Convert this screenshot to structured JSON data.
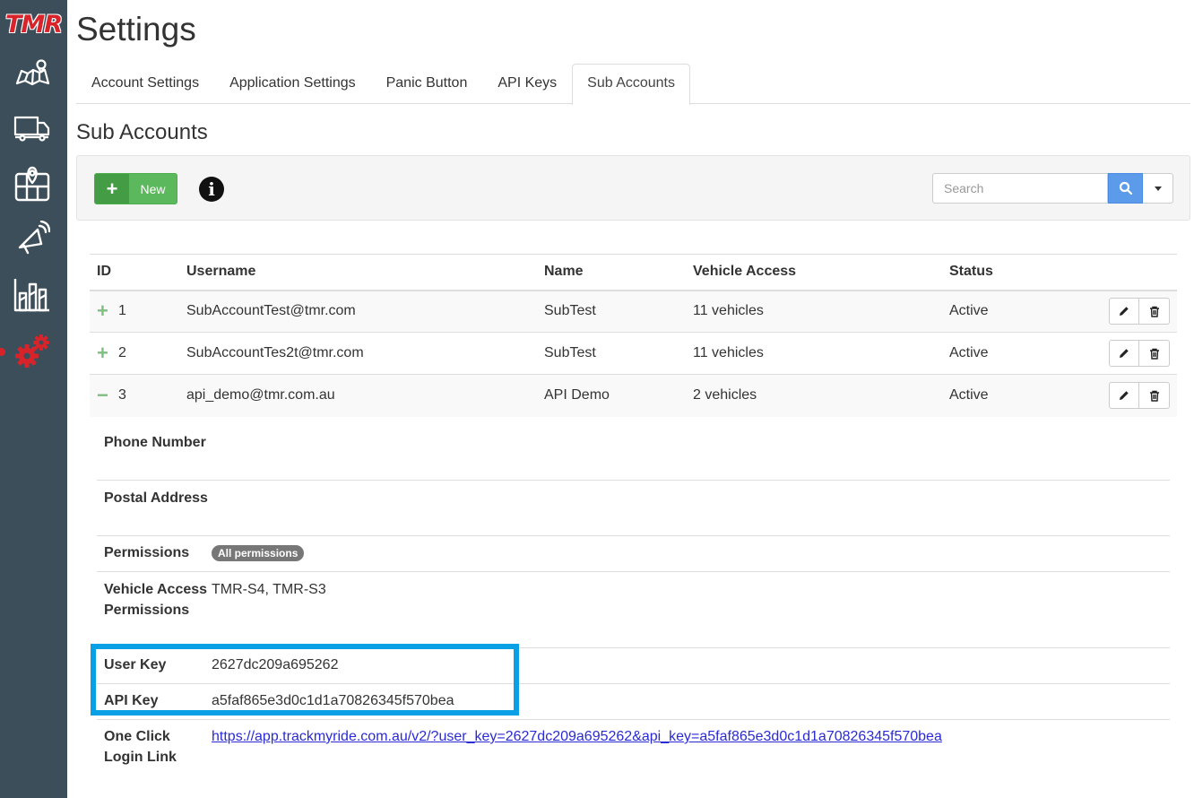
{
  "app": {
    "logo_text": "TMR",
    "accent_color": "#d9232a",
    "sidebar_color": "#3c4e5a"
  },
  "sidebar": {
    "items": [
      {
        "icon": "map-icon"
      },
      {
        "icon": "truck-icon"
      },
      {
        "icon": "location-map-icon"
      },
      {
        "icon": "megaphone-icon"
      },
      {
        "icon": "bar-chart-icon"
      },
      {
        "icon": "gears-icon",
        "active": true
      }
    ]
  },
  "header": {
    "title": "Settings",
    "tabs": [
      {
        "label": "Account Settings"
      },
      {
        "label": "Application Settings"
      },
      {
        "label": "Panic Button"
      },
      {
        "label": "API Keys"
      },
      {
        "label": "Sub Accounts",
        "active": true
      }
    ]
  },
  "section": {
    "title": "Sub Accounts"
  },
  "toolbar": {
    "new_label": "New",
    "search_placeholder": "Search"
  },
  "table": {
    "columns": [
      "ID",
      "Username",
      "Name",
      "Vehicle Access",
      "Status"
    ],
    "rows": [
      {
        "expand": "+",
        "id": "1",
        "username": "SubAccountTest@tmr.com",
        "name": "SubTest",
        "vehicle_access": "11 vehicles",
        "status": "Active"
      },
      {
        "expand": "+",
        "id": "2",
        "username": "SubAccountTes2t@tmr.com",
        "name": "SubTest",
        "vehicle_access": "11 vehicles",
        "status": "Active"
      },
      {
        "expand": "−",
        "id": "3",
        "username": "api_demo@tmr.com.au",
        "name": "API Demo",
        "vehicle_access": "2 vehicles",
        "status": "Active"
      }
    ]
  },
  "detail": {
    "phone_label": "Phone Number",
    "phone_value": "",
    "postal_label": "Postal Address",
    "postal_value": "",
    "permissions_label": "Permissions",
    "permissions_badge": "All permissions",
    "vehicle_perm_label": "Vehicle Access Permissions",
    "vehicle_perm_value": "TMR-S4, TMR-S3",
    "user_key_label": "User Key",
    "user_key_value": "2627dc209a695262",
    "api_key_label": "API Key",
    "api_key_value": "a5faf865e3d0c1d1a70826345f570bea",
    "login_link_label": "One Click Login Link",
    "login_link_value": "https://app.trackmyride.com.au/v2/?user_key=2627dc209a695262&api_key=a5faf865e3d0c1d1a70826345f570bea"
  }
}
